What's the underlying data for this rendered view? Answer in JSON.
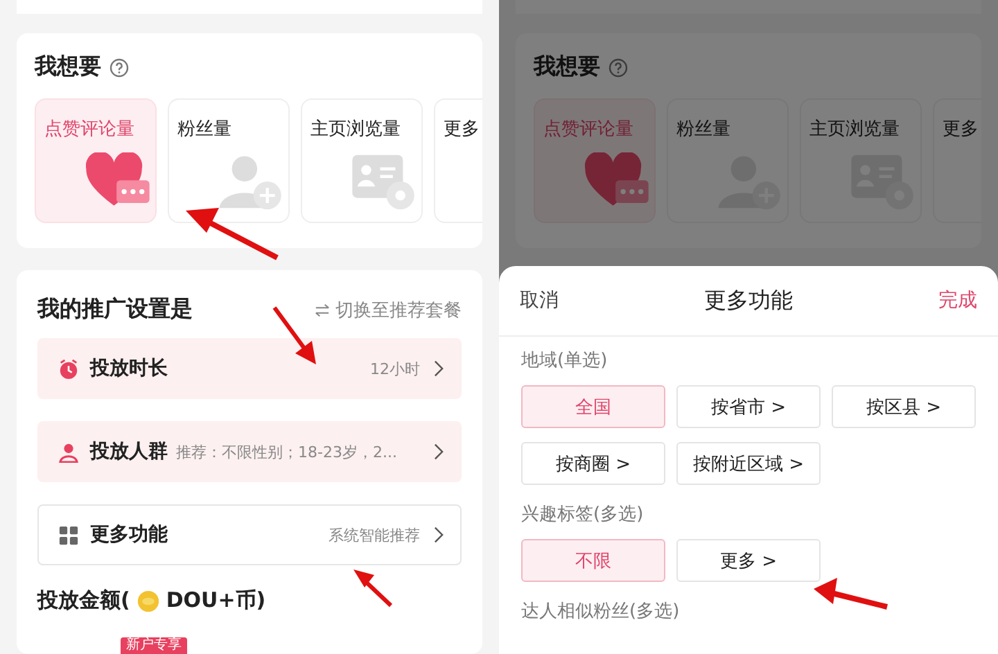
{
  "left_panel": {
    "goal_card": {
      "title": "我想要",
      "options": [
        {
          "label": "点赞评论量",
          "kind": "likes",
          "selected": true
        },
        {
          "label": "粉丝量",
          "kind": "fans",
          "selected": false
        },
        {
          "label": "主页浏览量",
          "kind": "homepage",
          "selected": false
        },
        {
          "label": "更多",
          "kind": "more",
          "selected": false
        }
      ]
    },
    "settings_card": {
      "title": "我的推广设置是",
      "switch_link": "切换至推荐套餐",
      "rows": [
        {
          "kind": "duration",
          "label": "投放时长",
          "value": "12小时",
          "highlighted": true
        },
        {
          "kind": "audience",
          "label": "投放人群",
          "value": "推荐：不限性别；18-23岁，2...",
          "highlighted": true
        },
        {
          "kind": "features",
          "label": "更多功能",
          "value": "系统智能推荐",
          "highlighted": false
        }
      ],
      "amount_prefix": "投放金额(",
      "amount_unit": "DOU+币)",
      "badge": "新户专享"
    }
  },
  "right_panel": {
    "goal_card": {
      "title": "我想要",
      "options": [
        {
          "label": "点赞评论量",
          "kind": "likes",
          "selected": true
        },
        {
          "label": "粉丝量",
          "kind": "fans",
          "selected": false
        },
        {
          "label": "主页浏览量",
          "kind": "homepage",
          "selected": false
        },
        {
          "label": "更多",
          "kind": "more",
          "selected": false
        }
      ]
    },
    "sheet": {
      "cancel": "取消",
      "title": "更多功能",
      "done": "完成",
      "groups": [
        {
          "title": "地域(单选)",
          "options": [
            {
              "label": "全国",
              "selected": true
            },
            {
              "label": "按省市 >",
              "selected": false
            },
            {
              "label": "按区县 >",
              "selected": false
            },
            {
              "label": "按商圈 >",
              "selected": false
            },
            {
              "label": "按附近区域 >",
              "selected": false
            }
          ]
        },
        {
          "title": "兴趣标签(多选)",
          "options": [
            {
              "label": "不限",
              "selected": true
            },
            {
              "label": "更多 >",
              "selected": false
            }
          ]
        },
        {
          "title": "达人相似粉丝(多选)"
        }
      ]
    }
  }
}
